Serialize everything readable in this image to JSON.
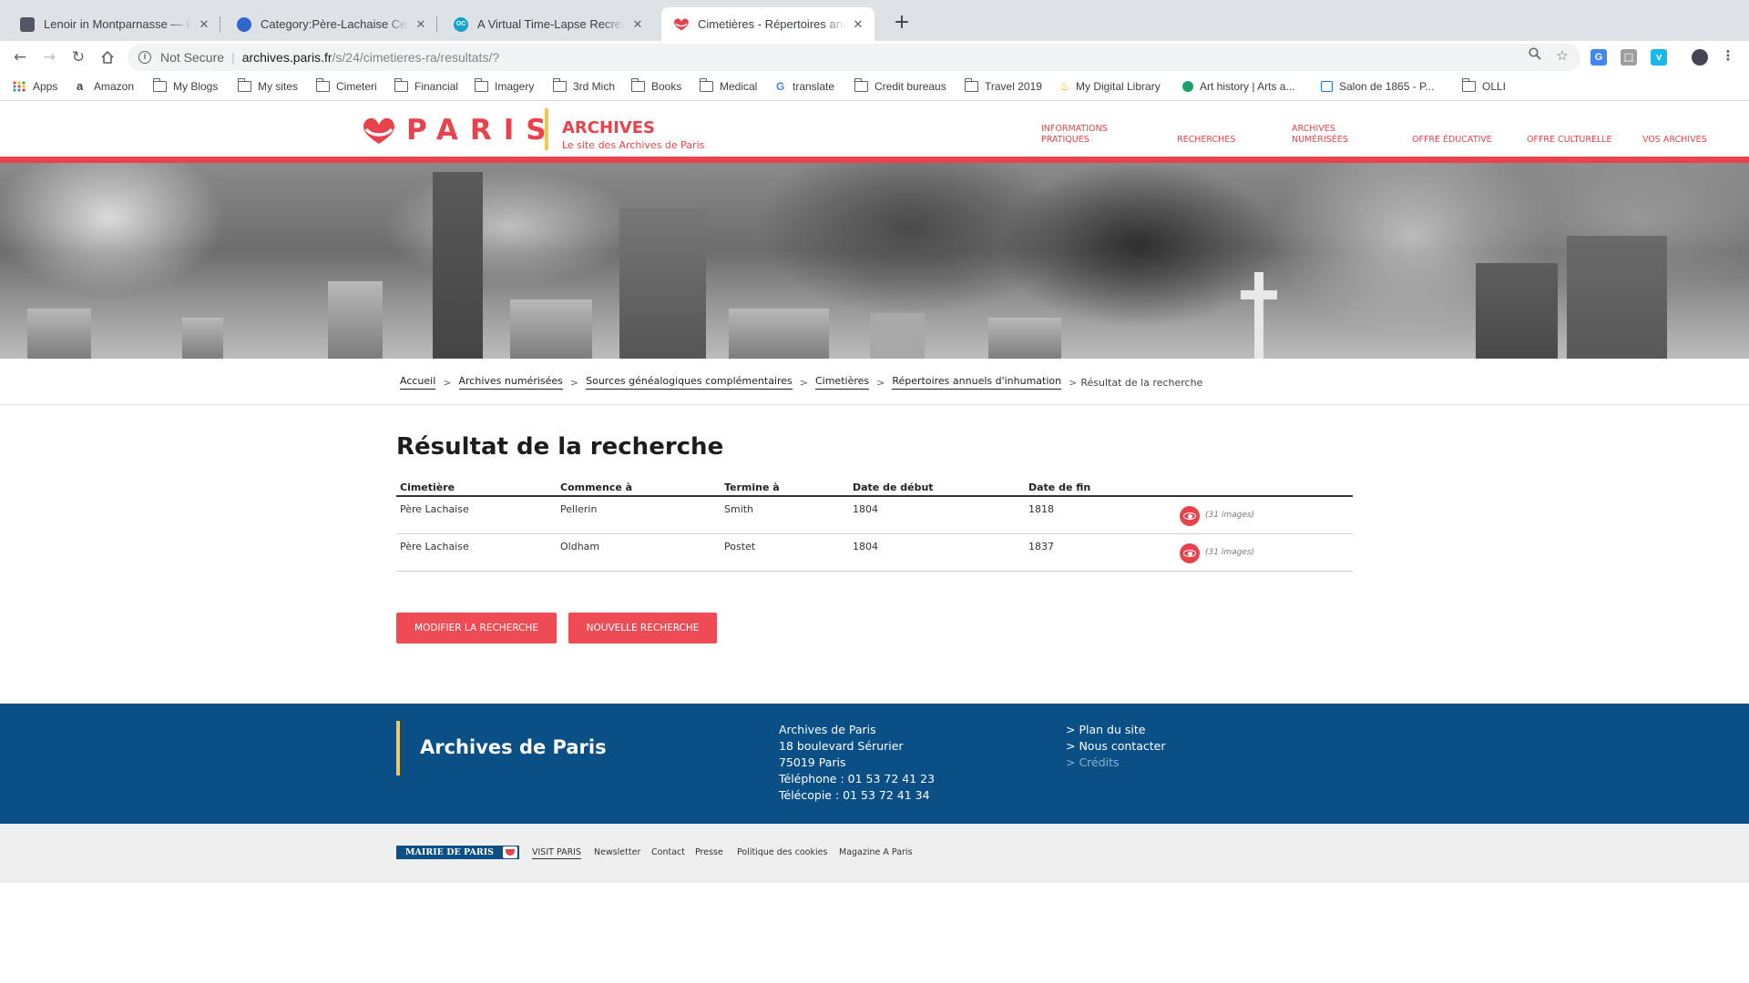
{
  "browser": {
    "tabs": [
      {
        "title": "Lenoir in Montparnasse — Paris",
        "active": false
      },
      {
        "title": "Category:Père-Lachaise Cemetery",
        "active": false
      },
      {
        "title": "A Virtual Time-Lapse Recreation",
        "active": false
      },
      {
        "title": "Cimetières - Répertoires annuels",
        "active": true
      }
    ],
    "new_tab": "+",
    "address": {
      "security": "Not Secure",
      "host": "archives.paris.fr",
      "path": "/s/24/cimetieres-ra/resultats/?"
    },
    "bookmarks": [
      {
        "label": "Apps",
        "icon": "apps-grid-icon"
      },
      {
        "label": "Amazon",
        "icon": "amazon-icon"
      },
      {
        "label": "My Blogs",
        "icon": "folder-icon"
      },
      {
        "label": "My sites",
        "icon": "folder-icon"
      },
      {
        "label": "Cimeteri",
        "icon": "folder-icon"
      },
      {
        "label": "Financial",
        "icon": "folder-icon"
      },
      {
        "label": "Imagery",
        "icon": "folder-icon"
      },
      {
        "label": "3rd Mich",
        "icon": "folder-icon"
      },
      {
        "label": "Books",
        "icon": "folder-icon"
      },
      {
        "label": "Medical",
        "icon": "folder-icon"
      },
      {
        "label": "translate",
        "icon": "google-icon"
      },
      {
        "label": "Credit bureaus",
        "icon": "folder-icon"
      },
      {
        "label": "Travel 2019",
        "icon": "folder-icon"
      },
      {
        "label": "My Digital Library",
        "icon": "flame-icon"
      },
      {
        "label": "Art history | Arts a...",
        "icon": "shield-check-icon"
      },
      {
        "label": "Salon de 1865 - P...",
        "icon": "page-icon"
      },
      {
        "label": "OLLI",
        "icon": "folder-icon"
      }
    ]
  },
  "site": {
    "logo_text": "PARIS",
    "archives_title": "ARCHIVES",
    "archives_subtitle": "Le site des Archives de Paris",
    "nav": [
      {
        "label": "INFORMATIONS PRATIQUES"
      },
      {
        "label": "RECHERCHES"
      },
      {
        "label": "ARCHIVES NUMÉRISÉES"
      },
      {
        "label": "OFFRE ÉDUCATIVE"
      },
      {
        "label": "OFFRE CULTURELLE"
      },
      {
        "label": "VOS ARCHIVES"
      }
    ],
    "accent_color": "#e8434c",
    "footer_color": "#0a4f85"
  },
  "breadcrumb": {
    "items": [
      "Accueil",
      "Archives numérisées",
      "Sources généalogiques complémentaires",
      "Cimetières",
      "Répertoires annuels d'inhumation"
    ],
    "current": "Résultat de la recherche",
    "separator": ">"
  },
  "results": {
    "title": "Résultat de la recherche",
    "columns": [
      "Cimetière",
      "Commence à",
      "Termine à",
      "Date de début",
      "Date de fin"
    ],
    "rows": [
      {
        "cimetiere": "Père Lachaise",
        "commence": "Pellerin",
        "termine": "Smith",
        "debut": "1804",
        "fin": "1818",
        "images": "(31 images)"
      },
      {
        "cimetiere": "Père Lachaise",
        "commence": "Oldham",
        "termine": "Postet",
        "debut": "1804",
        "fin": "1837",
        "images": "(31 images)"
      }
    ],
    "buttons": {
      "modify": "MODIFIER LA RECHERCHE",
      "new": "NOUVELLE RECHERCHE"
    }
  },
  "footer": {
    "title": "Archives de Paris",
    "address": [
      "Archives de Paris",
      "18 boulevard Sérurier",
      "75019 Paris",
      "Téléphone : 01 53 72 41 23",
      "Télécopie : 01 53 72 41 34"
    ],
    "links": [
      "> Plan du site",
      "> Nous contacter",
      "> Crédits"
    ]
  },
  "subfooter": {
    "mairie": "MAIRIE DE PARIS",
    "links": [
      "VISIT PARIS",
      "Newsletter",
      "Contact",
      "Presse",
      "Politique des cookies",
      "Magazine A Paris"
    ]
  }
}
